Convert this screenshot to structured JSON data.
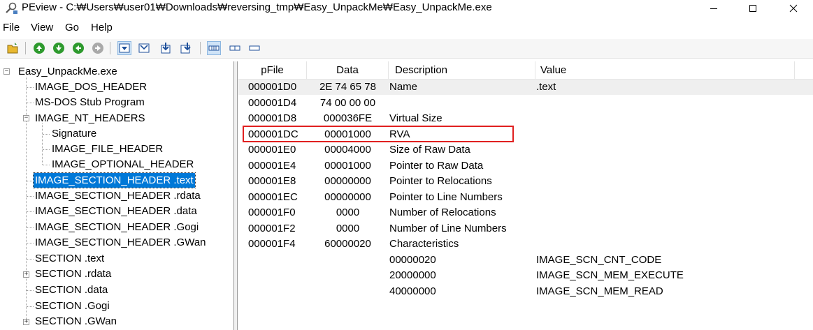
{
  "window": {
    "title": "PEview - C:₩Users₩user01₩Downloads₩reversing_tmp₩Easy_UnpackMe₩Easy_UnpackMe.exe"
  },
  "menu": [
    "File",
    "View",
    "Go",
    "Help"
  ],
  "toolbar": {
    "icons": [
      "open-icon",
      "back-icon",
      "down-icon",
      "forward-icon",
      "up-disabled-icon",
      "view-hex-icon",
      "view-section-icon",
      "view-down-icon",
      "view-jump-icon",
      "layout-byte-icon",
      "layout-word-icon",
      "layout-dword-icon"
    ]
  },
  "tree": {
    "root": "Easy_UnpackMe.exe",
    "items": [
      "IMAGE_DOS_HEADER",
      "MS-DOS Stub Program",
      "IMAGE_NT_HEADERS",
      "Signature",
      "IMAGE_FILE_HEADER",
      "IMAGE_OPTIONAL_HEADER",
      "IMAGE_SECTION_HEADER .text",
      "IMAGE_SECTION_HEADER .rdata",
      "IMAGE_SECTION_HEADER .data",
      "IMAGE_SECTION_HEADER .Gogi",
      "IMAGE_SECTION_HEADER .GWan",
      "SECTION .text",
      "SECTION .rdata",
      "SECTION .data",
      "SECTION .Gogi",
      "SECTION .GWan"
    ],
    "selected": "IMAGE_SECTION_HEADER .text"
  },
  "list": {
    "columns": [
      "pFile",
      "Data",
      "Description",
      "Value"
    ],
    "rows": [
      {
        "pfile": "000001D0",
        "data": "2E  74  65  78",
        "desc": "Name",
        "value": ".text"
      },
      {
        "pfile": "000001D4",
        "data": "74  00  00  00",
        "desc": "",
        "value": ""
      },
      {
        "pfile": "000001D8",
        "data": "000036FE",
        "desc": "Virtual Size",
        "value": ""
      },
      {
        "pfile": "000001DC",
        "data": "00001000",
        "desc": "RVA",
        "value": ""
      },
      {
        "pfile": "000001E0",
        "data": "00004000",
        "desc": "Size of Raw Data",
        "value": ""
      },
      {
        "pfile": "000001E4",
        "data": "00001000",
        "desc": "Pointer to Raw Data",
        "value": ""
      },
      {
        "pfile": "000001E8",
        "data": "00000000",
        "desc": "Pointer to Relocations",
        "value": ""
      },
      {
        "pfile": "000001EC",
        "data": "00000000",
        "desc": "Pointer to Line Numbers",
        "value": ""
      },
      {
        "pfile": "000001F0",
        "data": "0000",
        "desc": "Number of Relocations",
        "value": ""
      },
      {
        "pfile": "000001F2",
        "data": "0000",
        "desc": "Number of Line Numbers",
        "value": ""
      },
      {
        "pfile": "000001F4",
        "data": "60000020",
        "desc": "Characteristics",
        "value": ""
      },
      {
        "pfile": "",
        "data": "",
        "desc": "00000020",
        "value": "IMAGE_SCN_CNT_CODE"
      },
      {
        "pfile": "",
        "data": "",
        "desc": "20000000",
        "value": "IMAGE_SCN_MEM_EXECUTE"
      },
      {
        "pfile": "",
        "data": "",
        "desc": "40000000",
        "value": "IMAGE_SCN_MEM_READ"
      }
    ],
    "highlighted_row": "000001DC",
    "highlight_color": "#e02020"
  },
  "colors": {
    "selection": "#0078d7",
    "first_row_bg": "#efefef"
  }
}
